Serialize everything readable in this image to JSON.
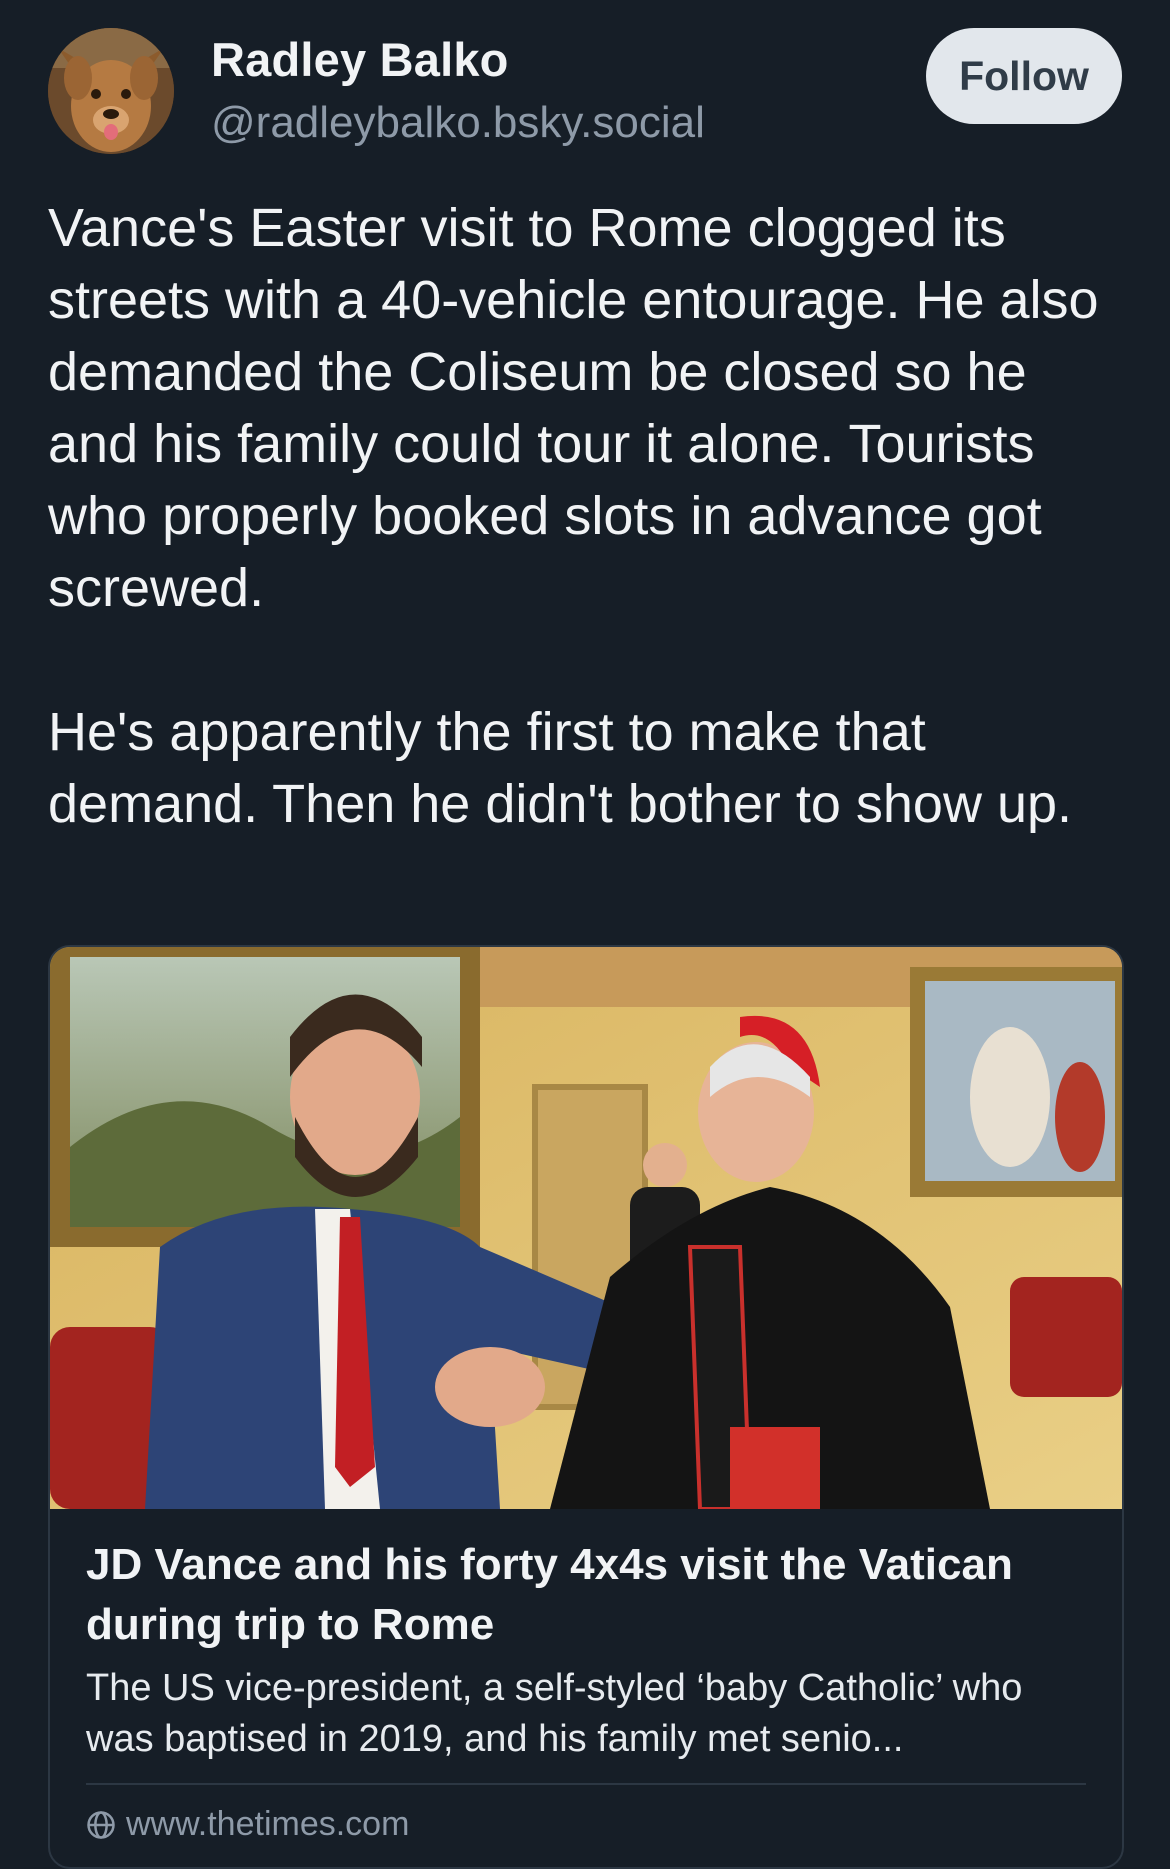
{
  "author": {
    "name": "Radley Balko",
    "handle": "@radleybalko.bsky.social",
    "avatar_icon": "dog-avatar"
  },
  "follow_button": {
    "label": "Follow"
  },
  "post": {
    "paragraphs": [
      "Vance's Easter visit to Rome clogged its streets with a 40-vehicle entourage. He also demanded the Coliseum be closed so he and his family could tour it alone. Tourists who properly booked slots in advance got screwed.",
      "He's apparently the first to make that demand. Then he didn't bother to show up."
    ]
  },
  "link_card": {
    "image_alt_icon": "photo-vance-and-cardinal",
    "title": "JD Vance and his forty 4x4s visit the Vatican during trip to Rome",
    "description": "The US vice-president, a self-styled ‘baby Catholic’ who was baptised in 2019, and his family met senio...",
    "domain": "www.thetimes.com",
    "domain_icon": "globe-icon"
  },
  "colors": {
    "background": "#161e27",
    "text": "#f1f3f5",
    "muted": "#8e9aa8",
    "button_bg": "#e2e7ec",
    "button_text": "#303c48",
    "border": "#2c3743"
  }
}
